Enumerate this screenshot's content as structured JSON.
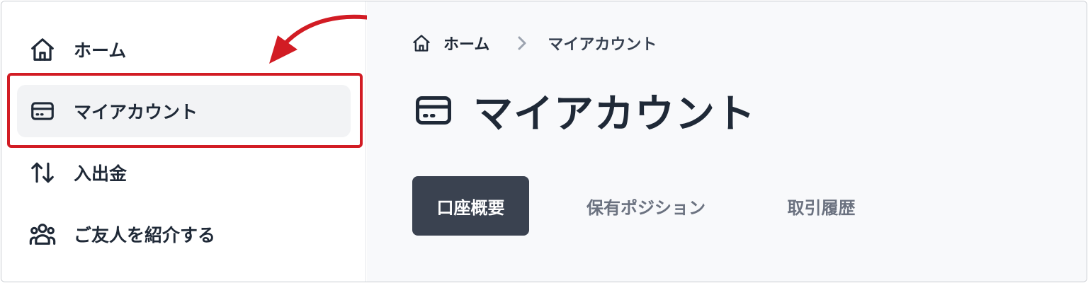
{
  "sidebar": {
    "items": [
      {
        "label": "ホーム",
        "icon": "home-icon",
        "active": false
      },
      {
        "label": "マイアカウント",
        "icon": "card-icon",
        "active": true
      },
      {
        "label": "入出金",
        "icon": "transfer-arrows-icon",
        "active": false
      },
      {
        "label": "ご友人を紹介する",
        "icon": "users-group-icon",
        "active": false
      }
    ]
  },
  "breadcrumb": {
    "home_label": "ホーム",
    "current_label": "マイアカウント"
  },
  "page": {
    "title": "マイアカウント"
  },
  "tabs": [
    {
      "label": "口座概要",
      "active": true
    },
    {
      "label": "保有ポジション",
      "active": false
    },
    {
      "label": "取引履歴",
      "active": false
    }
  ],
  "colors": {
    "highlight": "#d21c24",
    "active_tab_bg": "#3a4250",
    "sidebar_active_bg": "#f2f3f5",
    "main_bg": "#f8f9fb",
    "text": "#1f2937"
  }
}
